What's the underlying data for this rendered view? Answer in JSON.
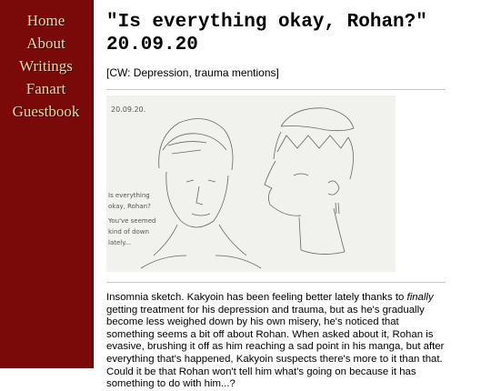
{
  "nav": [
    {
      "label": "Home"
    },
    {
      "label": "About"
    },
    {
      "label": "Writings"
    },
    {
      "label": "Fanart"
    },
    {
      "label": "Guestbook"
    }
  ],
  "post": {
    "title_line1": "\"Is everything okay, Rohan?\"",
    "title_line2": "20.09.20",
    "content_warning": "[CW: Depression, trauma mentions]",
    "sketch": {
      "date": "20.09.20.",
      "note_lines": [
        "Is everything",
        "okay, Rohan?",
        "You've seemed",
        "kind of down",
        "lately..."
      ]
    },
    "description": {
      "part1": "Insomnia sketch. Kakyoin has been feeling better lately thanks to ",
      "emphasis": "finally",
      "part2": " getting treatment for his depression and trauma, but as he's gradually become less weighed down by his own misery, he's noticed that something seems a bit off about Rohan. When asked about it, Rohan is evasive, brushing it off as him reaching a sad point in his manga, but after everything that's happened, Kakyoin suspects there's more to it than that. Could it be that Rohan won't tell him what's going on because it has something to do with him...?"
    }
  },
  "colors": {
    "sidebar": "#7a0a0a",
    "nav_text": "#e6d9a0",
    "paper": "#f1f1ee"
  }
}
